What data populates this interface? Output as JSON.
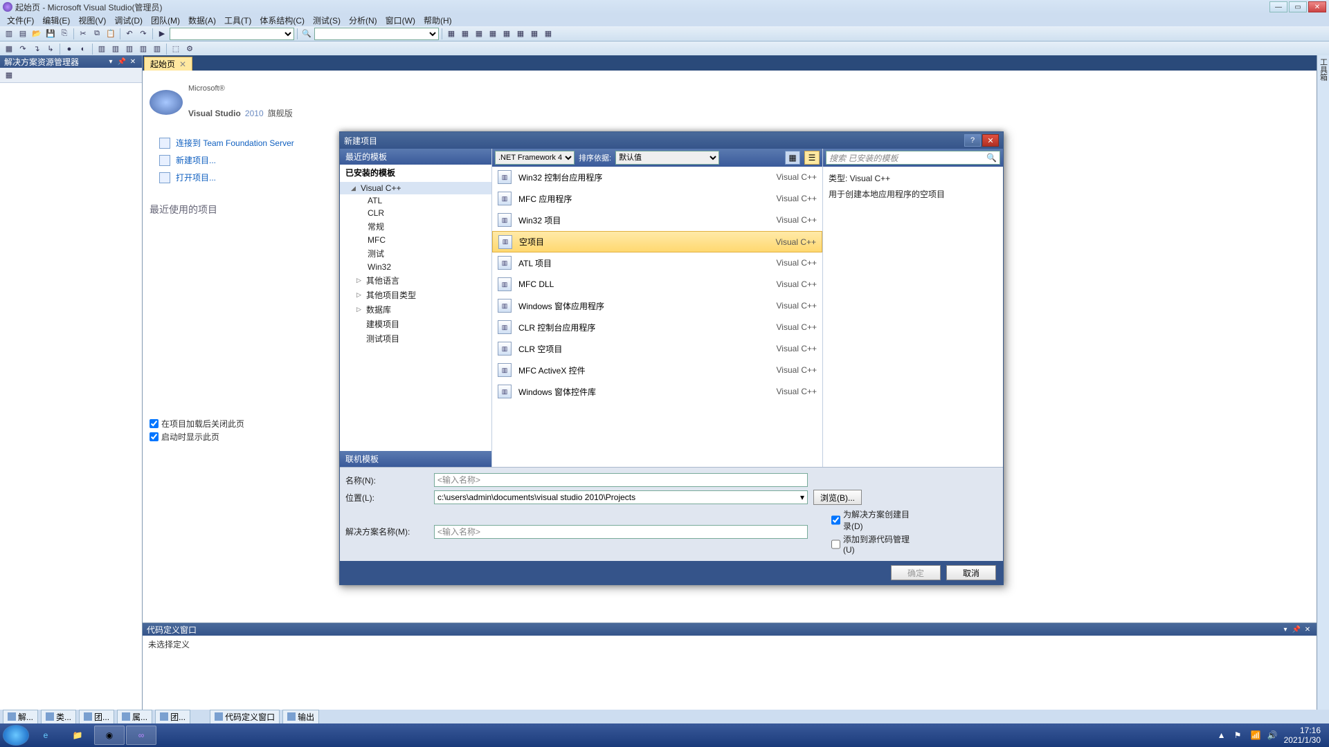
{
  "window": {
    "title": "起始页 - Microsoft Visual Studio(管理员)"
  },
  "menu": [
    "文件(F)",
    "编辑(E)",
    "视图(V)",
    "调试(D)",
    "团队(M)",
    "数据(A)",
    "工具(T)",
    "体系结构(C)",
    "测试(S)",
    "分析(N)",
    "窗口(W)",
    "帮助(H)"
  ],
  "solution_explorer": {
    "title": "解决方案资源管理器"
  },
  "tabs": {
    "start": "起始页"
  },
  "start_page": {
    "brand": "Visual Studio",
    "year": "2010",
    "edition": "旗舰版",
    "links": {
      "tfs": "连接到 Team Foundation Server",
      "new_proj": "新建项目...",
      "open_proj": "打开项目..."
    },
    "recent_h": "最近使用的项目",
    "chk_close": "在项目加载后关闭此页",
    "chk_show": "启动时显示此页"
  },
  "code_def": {
    "title": "代码定义窗口",
    "empty": "未选择定义"
  },
  "bottom_tabs": [
    "解...",
    "类...",
    "团...",
    "属...",
    "团...",
    "代码定义窗口",
    "输出"
  ],
  "right_rail": [
    "工具箱"
  ],
  "dialog": {
    "title": "新建项目",
    "cats": {
      "recent": "最近的模板",
      "installed": "已安装的模板",
      "online": "联机模板"
    },
    "tree": {
      "vcpp": "Visual C++",
      "sub": [
        "ATL",
        "CLR",
        "常规",
        "MFC",
        "测试",
        "Win32"
      ],
      "other_lang": "其他语言",
      "other_type": "其他项目类型",
      "db": "数据库",
      "model": "建模项目",
      "test": "测试项目"
    },
    "framework_label": ".NET Framework 4",
    "sort_label": "排序依据:",
    "sort_value": "默认值",
    "search_ph": "搜索 已安装的模板",
    "templates": [
      {
        "name": "Win32 控制台应用程序",
        "lang": "Visual C++"
      },
      {
        "name": "MFC 应用程序",
        "lang": "Visual C++"
      },
      {
        "name": "Win32 项目",
        "lang": "Visual C++"
      },
      {
        "name": "空项目",
        "lang": "Visual C++"
      },
      {
        "name": "ATL 项目",
        "lang": "Visual C++"
      },
      {
        "name": "MFC DLL",
        "lang": "Visual C++"
      },
      {
        "name": "Windows 窗体应用程序",
        "lang": "Visual C++"
      },
      {
        "name": "CLR 控制台应用程序",
        "lang": "Visual C++"
      },
      {
        "name": "CLR 空项目",
        "lang": "Visual C++"
      },
      {
        "name": "MFC ActiveX 控件",
        "lang": "Visual C++"
      },
      {
        "name": "Windows 窗体控件库",
        "lang": "Visual C++"
      }
    ],
    "selected_index": 3,
    "desc_type": "类型:  Visual C++",
    "desc_text": "用于创建本地应用程序的空项目",
    "form": {
      "name_l": "名称(N):",
      "name_ph": "<输入名称>",
      "loc_l": "位置(L):",
      "loc_v": "c:\\users\\admin\\documents\\visual studio 2010\\Projects",
      "sln_l": "解决方案名称(M):",
      "sln_ph": "<输入名称>",
      "browse": "浏览(B)...",
      "chk_dir": "为解决方案创建目录(D)",
      "chk_src": "添加到源代码管理(U)"
    },
    "ok": "确定",
    "cancel": "取消"
  },
  "taskbar": {
    "time": "17:16",
    "date": "2021/1/30"
  }
}
